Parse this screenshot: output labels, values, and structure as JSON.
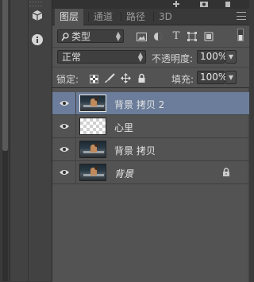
{
  "tabs": [
    {
      "label": "图层",
      "active": true
    },
    {
      "label": "通道",
      "active": false
    },
    {
      "label": "路径",
      "active": false
    },
    {
      "label": "3D",
      "active": false
    }
  ],
  "filter": {
    "kind_label": "类型"
  },
  "blend": {
    "mode": "正常",
    "opacity_label": "不透明度:",
    "opacity_value": "100%"
  },
  "lock": {
    "label": "锁定:",
    "fill_label": "填充:",
    "fill_value": "100%"
  },
  "layers": [
    {
      "name": "背景 拷贝 2",
      "selected": true,
      "thumb": "photo",
      "visible": true,
      "locked": false
    },
    {
      "name": "心里",
      "selected": false,
      "thumb": "transparent",
      "visible": true,
      "locked": false
    },
    {
      "name": "背景 拷贝",
      "selected": false,
      "thumb": "photo",
      "visible": true,
      "locked": false
    },
    {
      "name": "背景",
      "selected": false,
      "thumb": "photo",
      "visible": true,
      "locked": true,
      "italic": true
    }
  ],
  "colors": {
    "panel_bg": "#535353",
    "selected_row": "#6b7d9a",
    "tab_bar": "#393939"
  }
}
